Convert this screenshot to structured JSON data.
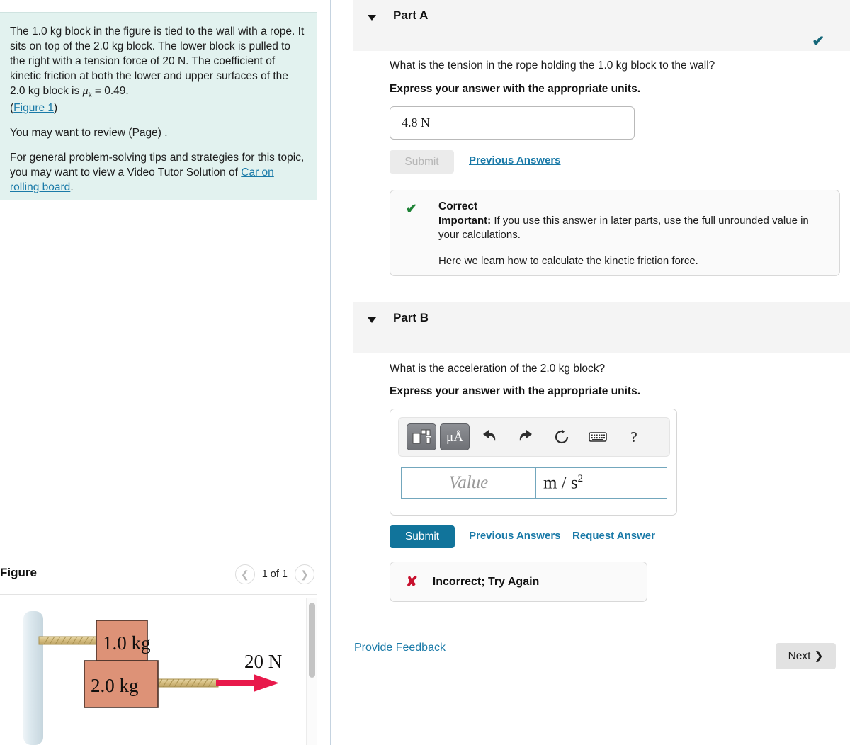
{
  "problem": {
    "paragraph1_a": "The 1.0 kg block in the figure is tied to the wall with a rope. It sits on top of the 2.0 kg block. The lower block is pulled to the right with a tension force of 20 N. The coefficient of kinetic friction at both the lower and upper surfaces of the 2.0 kg block is ",
    "mu_symbol": "μ",
    "mu_sub": "k",
    "mu_value": " = 0.49.",
    "figure_link": "Figure 1",
    "paren_open": "(",
    "paren_close": ")",
    "paragraph2": "You may want to review (Page) .",
    "paragraph3_a": "For general problem-solving tips and strategies for this topic, you may want to view a Video Tutor Solution of ",
    "paragraph3_link": "Car on rolling board",
    "paragraph3_b": "."
  },
  "figure_panel": {
    "title": "Figure",
    "prev_icon": "chevron-left-icon",
    "next_icon": "chevron-right-icon",
    "counter": "1 of 1",
    "diagram": {
      "block_upper_label": "1.0 kg",
      "block_lower_label": "2.0 kg",
      "force_label": "20 N",
      "wall_color": "#cfdce3",
      "block_color": "#dd9277",
      "rope_color": "#d9c38a",
      "arrow_color": "#e8194b"
    }
  },
  "part_a": {
    "caret_icon": "caret-down-icon",
    "label": "Part A",
    "status_icon": "check-icon",
    "question": "What is the tension in the rope holding the 1.0 kg block to the wall?",
    "instruction": "Express your answer with the appropriate units.",
    "answer_value": "4.8 N",
    "submit_label": "Submit",
    "previous_answers_label": "Previous Answers",
    "feedback": {
      "icon": "check-icon",
      "title": "Correct",
      "important_label": "Important:",
      "important_text": " If you use this answer in later parts, use the full unrounded value in your calculations.",
      "note": "Here we learn how to calculate the kinetic friction force."
    }
  },
  "part_b": {
    "caret_icon": "caret-down-icon",
    "label": "Part B",
    "question": "What is the acceleration of the 2.0 kg block?",
    "instruction": "Express your answer with the appropriate units.",
    "toolbar": [
      {
        "name": "math-template-icon",
        "glyph": ""
      },
      {
        "name": "units-icon",
        "glyph": "μÅ"
      },
      {
        "name": "undo-icon",
        "glyph": "↰"
      },
      {
        "name": "redo-icon",
        "glyph": "↱"
      },
      {
        "name": "reset-icon",
        "glyph": "↻"
      },
      {
        "name": "keyboard-icon",
        "glyph": "⌨"
      },
      {
        "name": "help-icon",
        "glyph": "?"
      }
    ],
    "value_placeholder": "Value",
    "unit_base": "m / s",
    "unit_exp": "2",
    "submit_label": "Submit",
    "previous_answers_label": "Previous Answers",
    "request_answer_label": "Request Answer",
    "feedback": {
      "icon": "cross-icon",
      "text": "Incorrect; Try Again"
    }
  },
  "footer": {
    "feedback_link": "Provide Feedback",
    "next_label": "Next",
    "next_icon": "chevron-right-icon"
  },
  "colors": {
    "accent_link": "#1a7aa8",
    "submit_active": "#11749b",
    "correct_green": "#1d8235",
    "incorrect_red": "#c8102e",
    "check_teal": "#156779",
    "problem_bg": "#e2f2ef"
  }
}
